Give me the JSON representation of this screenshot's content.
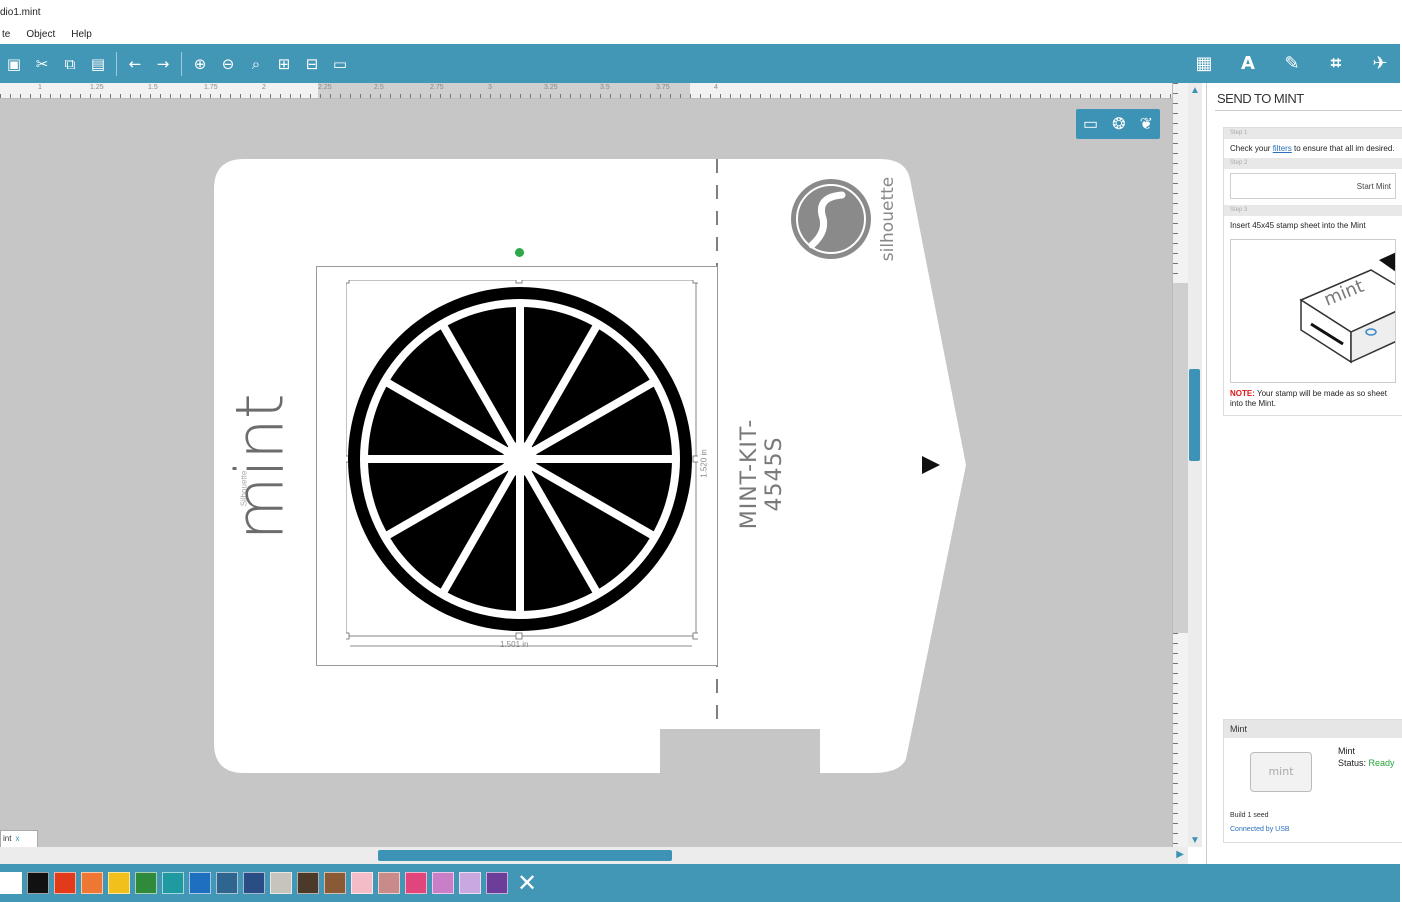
{
  "window": {
    "title": "dio1.mint"
  },
  "menu": [
    "te",
    "Object",
    "Help"
  ],
  "toolbar": {
    "left_icons": [
      "save-icon",
      "cut-icon",
      "copy-icon",
      "paste-icon",
      "undo-icon",
      "redo-icon",
      "zoom-in-icon",
      "zoom-out-icon",
      "zoom-select-icon",
      "zoom-fit-icon",
      "zoom-page-icon",
      "fit-page-icon"
    ],
    "right_icons": [
      "grid-icon",
      "text-icon",
      "draw-icon",
      "crop-icon",
      "send-icon"
    ],
    "text_glyph": "A"
  },
  "ruler": {
    "labels": [
      "1",
      "1.25",
      "1.5",
      "1.75",
      "2",
      "2.25",
      "2.5",
      "2.75",
      "3",
      "3.25",
      "3.5",
      "3.75",
      "4"
    ]
  },
  "board": {
    "brand_small": "Silhouette",
    "brand_word": "mint",
    "kit_code": "MINT-KIT-4545S",
    "silhouette_word": "silhouette",
    "dim_width": "1.501 in",
    "dim_height": "1.520 in"
  },
  "tabs": [
    {
      "label": "int",
      "close": "x"
    }
  ],
  "palette": [
    "#ffffff",
    "#111111",
    "#e23b1c",
    "#ee7733",
    "#f2c01a",
    "#2f8a3c",
    "#1f9aa0",
    "#1f6fc0",
    "#2e6690",
    "#2a4d85",
    "#c7c4be",
    "#4b3a2a",
    "#8a5a36",
    "#f4bcc6",
    "#c98a8a",
    "#e0457b",
    "#c97ec8",
    "#c9a8e0",
    "#6c3e9a"
  ],
  "panel": {
    "title": "SEND TO MINT",
    "step1": {
      "header": "Step 1",
      "text_a": "Check your ",
      "link": "filters",
      "text_b": " to ensure that all im desired."
    },
    "step2": {
      "header": "Step 2",
      "button": "Start Mint"
    },
    "step3": {
      "header": "Step 3",
      "text": "Insert 45x45 stamp sheet into the Mint",
      "note_label": "NOTE:",
      "note_text": " Your stamp will be made as so sheet into the Mint."
    },
    "device": {
      "header": "Mint",
      "image_word": "mint",
      "name": "Mint",
      "status_label": "Status: ",
      "status_value": "Ready",
      "build": "Build 1 seed",
      "connection": "Connected by USB"
    }
  }
}
